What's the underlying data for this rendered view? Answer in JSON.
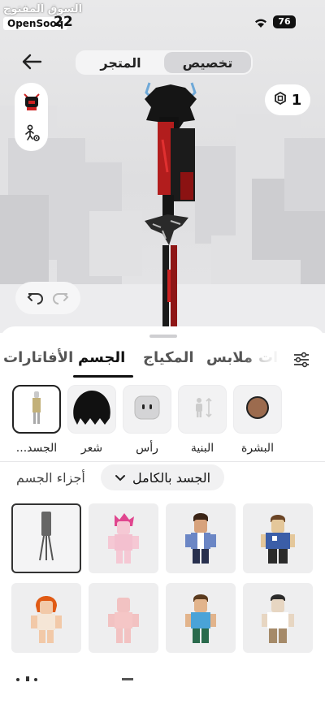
{
  "statusbar": {
    "watermark_arabic": "السوق المفتوح",
    "watermark_brand": "OpenSooq",
    "time": "22",
    "battery": "76"
  },
  "header": {
    "segment": [
      {
        "label": "تخصيص",
        "active": true
      },
      {
        "label": "المتجر",
        "active": false
      }
    ],
    "currency": {
      "icon": "robux-icon",
      "amount": "1"
    }
  },
  "tabs": [
    {
      "label": "الأفاتارات",
      "active": false
    },
    {
      "label": "الجسم",
      "active": true
    },
    {
      "label": "المكياج",
      "active": false
    },
    {
      "label": "ملابس",
      "active": false
    },
    {
      "label": "ات",
      "active": false
    }
  ],
  "categories": [
    {
      "label": "البشرة",
      "icon": "skin-tone-icon"
    },
    {
      "label": "البنية",
      "icon": "body-scale-icon"
    },
    {
      "label": "رأس",
      "icon": "head-icon"
    },
    {
      "label": "شعر",
      "icon": "hair-icon"
    },
    {
      "label": "الجسد...",
      "icon": "body-part-icon",
      "selected": true
    }
  ],
  "breadcrumb": {
    "label": "أجزاء الجسم",
    "dropdown": "الجسد بالكامل"
  },
  "colors": {
    "accent": "#111111",
    "skin_swatch": "#9c6b4e"
  }
}
